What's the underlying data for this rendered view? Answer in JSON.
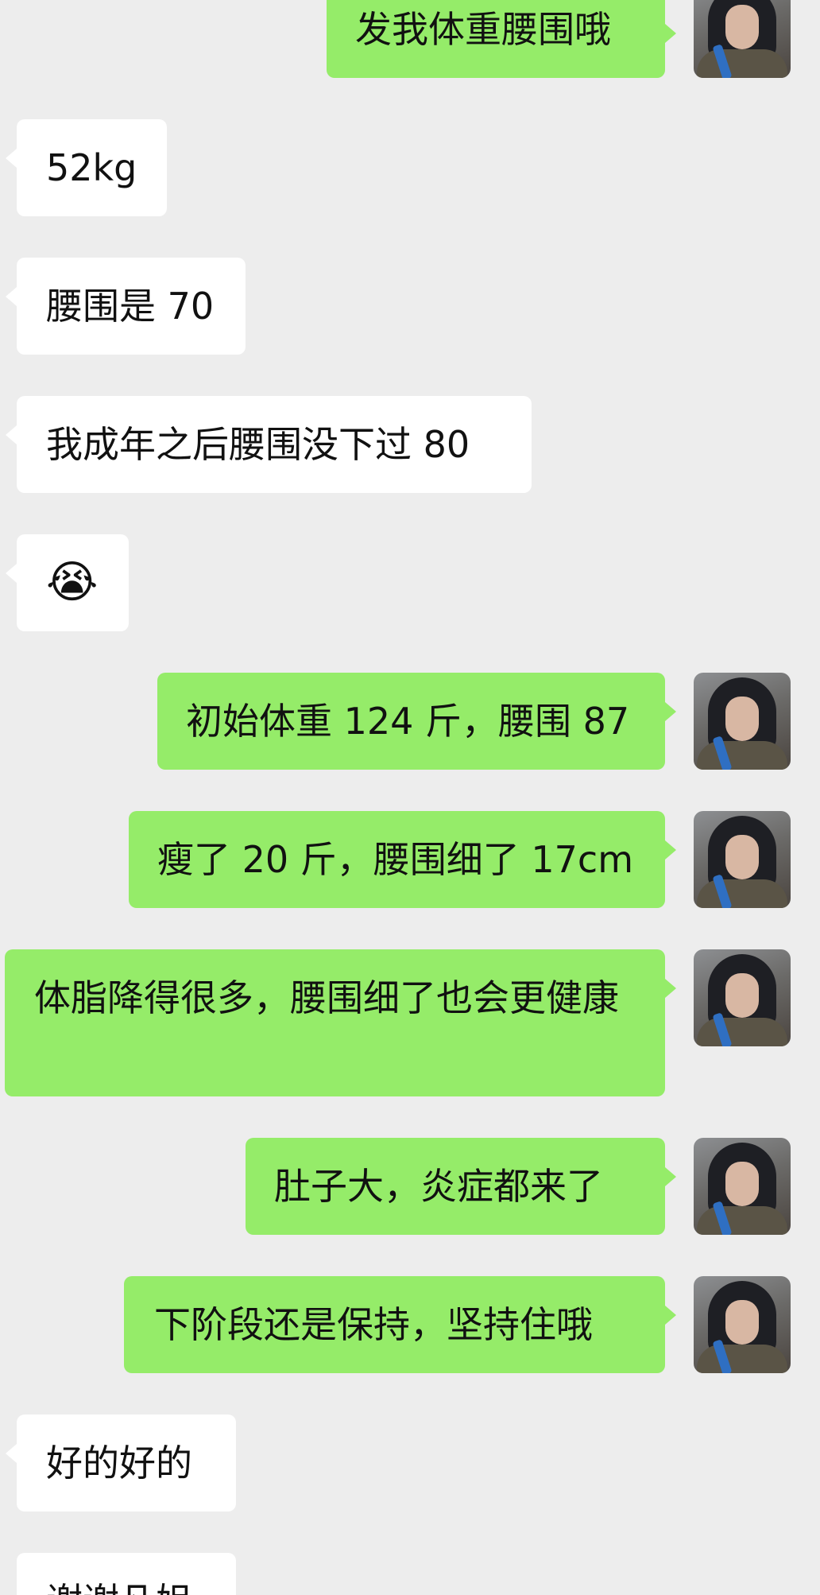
{
  "messages": [
    {
      "side": "out",
      "text": "发我体重腰围哦"
    },
    {
      "side": "in",
      "text": "52kg"
    },
    {
      "side": "in",
      "text": "腰围是 70"
    },
    {
      "side": "in",
      "text": "我成年之后腰围没下过 80"
    },
    {
      "side": "in",
      "text": "😭"
    },
    {
      "side": "out",
      "text": "初始体重 124 斤，腰围 87"
    },
    {
      "side": "out",
      "text": "瘦了 20 斤，腰围细了 17cm"
    },
    {
      "side": "out",
      "text": "体脂降得很多，腰围细了也会更健康"
    },
    {
      "side": "out",
      "text": "肚子大，炎症都来了"
    },
    {
      "side": "out",
      "text": "下阶段还是保持，坚持住哦"
    },
    {
      "side": "in",
      "text": "好的好的"
    },
    {
      "side": "in",
      "text": "谢谢凡姐"
    }
  ],
  "colors": {
    "background": "#ededed",
    "outgoing_bubble": "#95ec69",
    "incoming_bubble": "#ffffff"
  }
}
